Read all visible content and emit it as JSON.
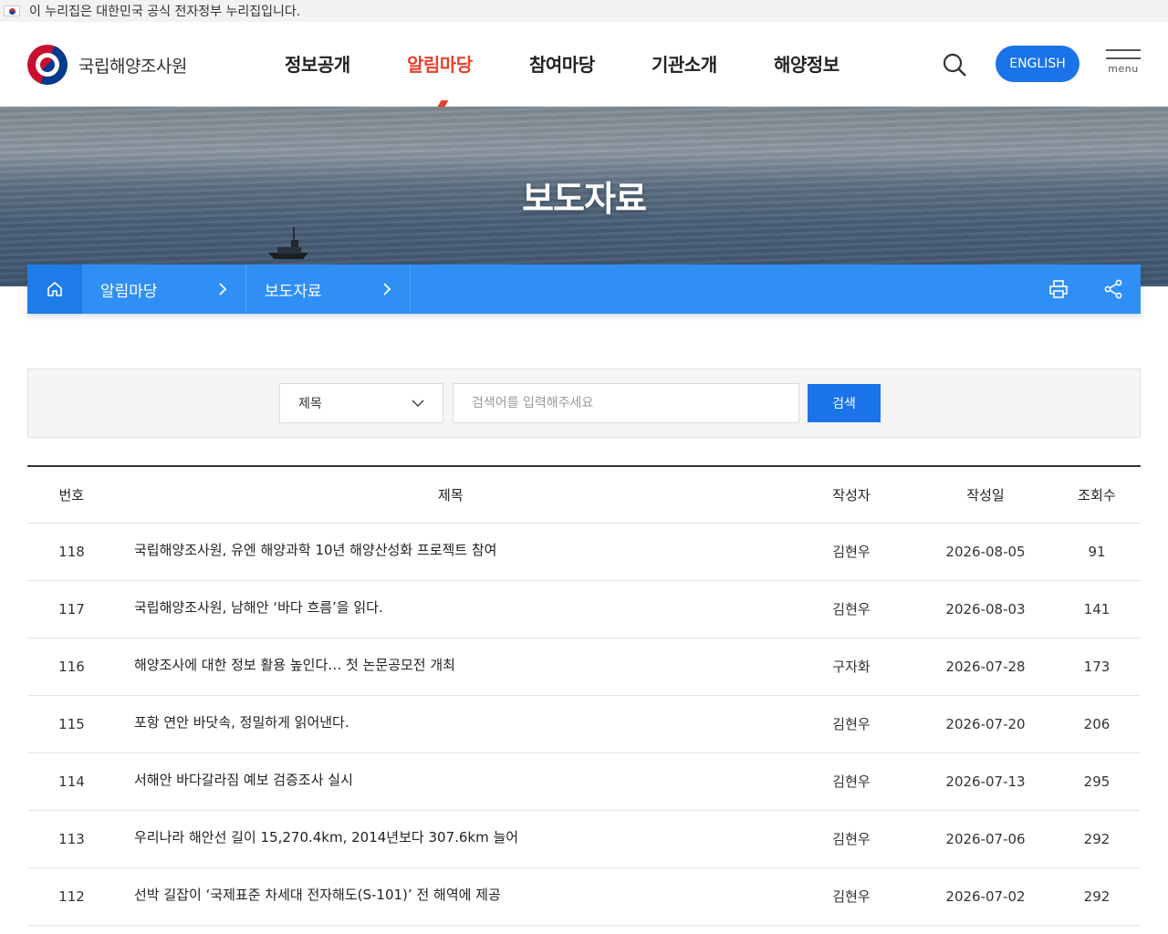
{
  "gov_banner": {
    "text": "이 누리집은 대한민국 공식 전자정부 누리집입니다."
  },
  "header": {
    "logo_text": "국립해양조사원",
    "nav": [
      "정보공개",
      "알림마당",
      "참여마당",
      "기관소개",
      "해양정보"
    ],
    "active_nav": "알림마당",
    "english_label": "ENGLISH",
    "menu_label": "menu"
  },
  "hero": {
    "title": "보도자료"
  },
  "location": {
    "crumbs": [
      "알림마당",
      "보도자료"
    ]
  },
  "search": {
    "select_value": "제목",
    "placeholder": "검색어를 입력해주세요",
    "button_label": "검색"
  },
  "table": {
    "headers": [
      "번호",
      "제목",
      "작성자",
      "작성일",
      "조회수"
    ],
    "rows": [
      {
        "no": "118",
        "title": "국립해양조사원, 유엔 해양과학 10년 해양산성화 프로젝트 참여",
        "author": "김현우",
        "date": "2026-08-05",
        "views": "91"
      },
      {
        "no": "117",
        "title": "국립해양조사원, 남해안 ‘바다 흐름’을 읽다.",
        "author": "김현우",
        "date": "2026-08-03",
        "views": "141"
      },
      {
        "no": "116",
        "title": "해양조사에 대한 정보 활용 높인다… 첫 논문공모전 개최",
        "author": "구자화",
        "date": "2026-07-28",
        "views": "173"
      },
      {
        "no": "115",
        "title": "포항 연안 바닷속, 정밀하게 읽어낸다.",
        "author": "김현우",
        "date": "2026-07-20",
        "views": "206"
      },
      {
        "no": "114",
        "title": "서해안 바다갈라짐 예보 검증조사 실시",
        "author": "김현우",
        "date": "2026-07-13",
        "views": "295"
      },
      {
        "no": "113",
        "title": "우리나라 해안선 길이 15,270.4km, 2014년보다 307.6km 늘어",
        "author": "김현우",
        "date": "2026-07-06",
        "views": "292"
      },
      {
        "no": "112",
        "title": "선박 길잡이 ‘국제표준 차세대 전자해도(S-101)’ 전 해역에 제공",
        "author": "김현우",
        "date": "2026-07-02",
        "views": "292"
      }
    ]
  },
  "colors": {
    "accent": "#1a73e8",
    "nav_active": "#e8412c",
    "location_bar": "#2f8ff5"
  }
}
